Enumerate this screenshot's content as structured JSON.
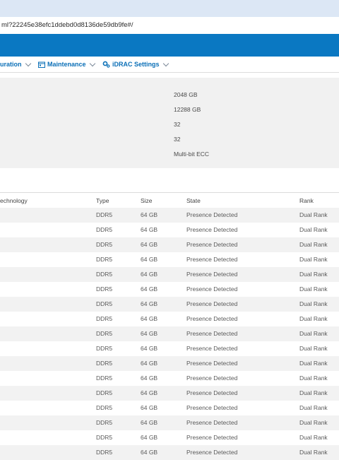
{
  "browser": {
    "url": "ml?22245e38efc1ddebd0d8136de59db9fe#/"
  },
  "nav": {
    "items": [
      {
        "label": "uration"
      },
      {
        "label": "Maintenance"
      },
      {
        "label": "iDRAC Settings"
      }
    ]
  },
  "summary": {
    "values": [
      "2048 GB",
      "12288 GB",
      "32",
      "32",
      "Multi-bit ECC"
    ]
  },
  "table": {
    "headers": {
      "technology": "echnology",
      "type": "Type",
      "size": "Size",
      "state": "State",
      "rank": "Rank"
    },
    "rows": [
      {
        "type": "DDR5",
        "size": "64 GB",
        "state": "Presence Detected",
        "rank": "Dual Rank"
      },
      {
        "type": "DDR5",
        "size": "64 GB",
        "state": "Presence Detected",
        "rank": "Dual Rank"
      },
      {
        "type": "DDR5",
        "size": "64 GB",
        "state": "Presence Detected",
        "rank": "Dual Rank"
      },
      {
        "type": "DDR5",
        "size": "64 GB",
        "state": "Presence Detected",
        "rank": "Dual Rank"
      },
      {
        "type": "DDR5",
        "size": "64 GB",
        "state": "Presence Detected",
        "rank": "Dual Rank"
      },
      {
        "type": "DDR5",
        "size": "64 GB",
        "state": "Presence Detected",
        "rank": "Dual Rank"
      },
      {
        "type": "DDR5",
        "size": "64 GB",
        "state": "Presence Detected",
        "rank": "Dual Rank"
      },
      {
        "type": "DDR5",
        "size": "64 GB",
        "state": "Presence Detected",
        "rank": "Dual Rank"
      },
      {
        "type": "DDR5",
        "size": "64 GB",
        "state": "Presence Detected",
        "rank": "Dual Rank"
      },
      {
        "type": "DDR5",
        "size": "64 GB",
        "state": "Presence Detected",
        "rank": "Dual Rank"
      },
      {
        "type": "DDR5",
        "size": "64 GB",
        "state": "Presence Detected",
        "rank": "Dual Rank"
      },
      {
        "type": "DDR5",
        "size": "64 GB",
        "state": "Presence Detected",
        "rank": "Dual Rank"
      },
      {
        "type": "DDR5",
        "size": "64 GB",
        "state": "Presence Detected",
        "rank": "Dual Rank"
      },
      {
        "type": "DDR5",
        "size": "64 GB",
        "state": "Presence Detected",
        "rank": "Dual Rank"
      },
      {
        "type": "DDR5",
        "size": "64 GB",
        "state": "Presence Detected",
        "rank": "Dual Rank"
      },
      {
        "type": "DDR5",
        "size": "64 GB",
        "state": "Presence Detected",
        "rank": "Dual Rank"
      },
      {
        "type": "DDR5",
        "size": "64 GB",
        "state": "Presence Detected",
        "rank": "Dual Rank"
      }
    ]
  },
  "colors": {
    "header_blue": "#0a78c2",
    "nav_link": "#0a6fb7",
    "tab_strip": "#dce7f5",
    "summary_bg": "#f1f1f1",
    "row_alt": "#f2f2f2"
  },
  "icons": {
    "maintenance": "maintenance-calendar-icon",
    "idrac_settings": "settings-gears-icon",
    "dropdown": "chevron-down-icon"
  }
}
